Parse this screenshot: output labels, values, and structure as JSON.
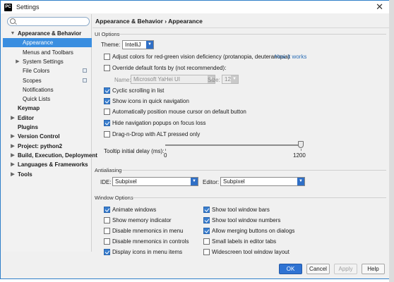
{
  "window": {
    "title": "Settings",
    "app_icon": "pc-icon"
  },
  "search": {
    "placeholder": "",
    "value": ""
  },
  "sidebar": {
    "items": [
      {
        "label": "Appearance & Behavior",
        "arrow": "▼",
        "bold": true
      },
      {
        "label": "Appearance",
        "selected": true
      },
      {
        "label": "Menus and Toolbars"
      },
      {
        "label": "System Settings",
        "arrow": "▶"
      },
      {
        "label": "File Colors",
        "project_icon": true
      },
      {
        "label": "Scopes",
        "project_icon": true
      },
      {
        "label": "Notifications"
      },
      {
        "label": "Quick Lists"
      },
      {
        "label": "Keymap",
        "bold": true
      },
      {
        "label": "Editor",
        "arrow": "▶",
        "bold": true
      },
      {
        "label": "Plugins",
        "bold": true
      },
      {
        "label": "Version Control",
        "arrow": "▶",
        "bold": true
      },
      {
        "label": "Project: python2",
        "arrow": "▶",
        "bold": true
      },
      {
        "label": "Build, Execution, Deployment",
        "arrow": "▶",
        "bold": true
      },
      {
        "label": "Languages & Frameworks",
        "arrow": "▶",
        "bold": true
      },
      {
        "label": "Tools",
        "arrow": "▶",
        "bold": true
      }
    ]
  },
  "main": {
    "breadcrumb": "Appearance & Behavior › Appearance",
    "ui_options": {
      "section": "UI Options",
      "theme_label": "Theme:",
      "theme_value": "IntelliJ",
      "adjust_colors": {
        "label": "Adjust colors for red-green vision deficiency (protanopia, deuteranopia)",
        "checked": false
      },
      "how_it_works": "How it works",
      "override_fonts": {
        "label": "Override default fonts by (not recommended):",
        "checked": false
      },
      "name_label": "Name:",
      "name_value": "Microsoft YaHei UI",
      "size_label": "Size:",
      "size_value": "12",
      "cyclic": {
        "label": "Cyclic scrolling in list",
        "checked": true
      },
      "show_icons": {
        "label": "Show icons in quick navigation",
        "checked": true
      },
      "auto_mouse": {
        "label": "Automatically position mouse cursor on default button",
        "checked": false
      },
      "hide_popups": {
        "label": "Hide navigation popups on focus loss",
        "checked": true
      },
      "drag_drop": {
        "label": "Drag-n-Drop with ALT pressed only",
        "checked": false
      },
      "tooltip_label": "Tooltip initial delay (ms):",
      "tooltip_min": "0",
      "tooltip_max": "1200",
      "tooltip_value": 1200
    },
    "antialiasing": {
      "section": "Antialiasing",
      "ide_label": "IDE:",
      "ide_value": "Subpixel",
      "editor_label": "Editor:",
      "editor_value": "Subpixel"
    },
    "window_options": {
      "section": "Window Options",
      "left": [
        {
          "label": "Animate windows",
          "checked": true
        },
        {
          "label": "Show memory indicator",
          "checked": false
        },
        {
          "label": "Disable mnemonics in menu",
          "checked": false
        },
        {
          "label": "Disable mnemonics in controls",
          "checked": false
        },
        {
          "label": "Display icons in menu items",
          "checked": true
        }
      ],
      "right": [
        {
          "label": "Show tool window bars",
          "checked": true
        },
        {
          "label": "Show tool window numbers",
          "checked": true
        },
        {
          "label": "Allow merging buttons on dialogs",
          "checked": true
        },
        {
          "label": "Small labels in editor tabs",
          "checked": false
        },
        {
          "label": "Widescreen tool window layout",
          "checked": false
        }
      ]
    }
  },
  "buttons": {
    "ok": "OK",
    "cancel": "Cancel",
    "apply": "Apply",
    "help": "Help"
  },
  "colors": {
    "accent": "#3a8ee0",
    "link": "#2a6db5",
    "primary_button": "#2f73d3"
  }
}
